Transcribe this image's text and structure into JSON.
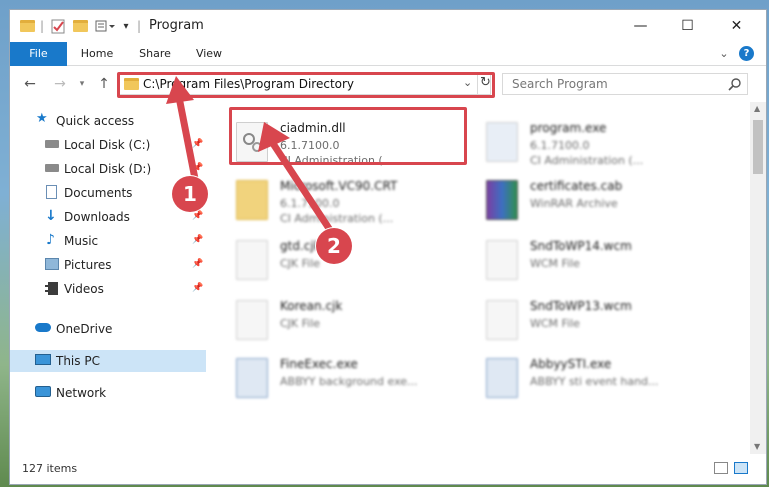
{
  "window": {
    "title": "Program",
    "controls": {
      "minimize": "—",
      "maximize": "☐",
      "close": "✕"
    }
  },
  "ribbon": {
    "tabs": [
      "File",
      "Home",
      "Share",
      "View"
    ],
    "expand_glyph": "⌄",
    "help_glyph": "?"
  },
  "address": {
    "path": "C:\\Program Files\\Program Directory",
    "search_placeholder": "Search Program"
  },
  "sidebar": {
    "items": [
      {
        "label": "Quick access",
        "icon": "star-icon"
      },
      {
        "label": "Local Disk (C:)",
        "icon": "drive-icon",
        "pinned": true
      },
      {
        "label": "Local Disk (D:)",
        "icon": "drive-icon",
        "pinned": true
      },
      {
        "label": "Documents",
        "icon": "documents-icon",
        "pinned": true
      },
      {
        "label": "Downloads",
        "icon": "download-icon",
        "pinned": true
      },
      {
        "label": "Music",
        "icon": "music-icon",
        "pinned": true
      },
      {
        "label": "Pictures",
        "icon": "pictures-icon",
        "pinned": true
      },
      {
        "label": "Videos",
        "icon": "videos-icon",
        "pinned": true
      },
      {
        "label": "OneDrive",
        "icon": "cloud-icon"
      },
      {
        "label": "This PC",
        "icon": "monitor-icon",
        "selected": true
      },
      {
        "label": "Network",
        "icon": "network-icon"
      }
    ]
  },
  "files": [
    {
      "name": "ciadmin.dll",
      "line2": "6.1.7100.0",
      "line3": "CI Administration (..."
    },
    {
      "name": "program.exe",
      "line2": "6.1.7100.0",
      "line3": "CI Administration (..."
    },
    {
      "name": "Microsoft.VC90.CRT",
      "line2": "6.1.7100.0",
      "line3": "CI Administration (..."
    },
    {
      "name": "certificates.cab",
      "line2": "WinRAR Archive",
      "line3": ""
    },
    {
      "name": "gtd.cjk",
      "line2": "CJK File",
      "line3": ""
    },
    {
      "name": "SndToWP14.wcm",
      "line2": "WCM File",
      "line3": ""
    },
    {
      "name": "Korean.cjk",
      "line2": "CJK File",
      "line3": ""
    },
    {
      "name": "SndToWP13.wcm",
      "line2": "WCM File",
      "line3": ""
    },
    {
      "name": "FineExec.exe",
      "line2": "ABBYY background exe...",
      "line3": ""
    },
    {
      "name": "AbbyySTI.exe",
      "line2": "ABBYY sti event hand...",
      "line3": ""
    }
  ],
  "status": {
    "item_count": "127 items"
  },
  "annotations": {
    "step1": "1",
    "step2": "2"
  },
  "colors": {
    "accent": "#1979ca",
    "annotation_red": "#d8464e",
    "selected_nav": "#cce4f7"
  }
}
